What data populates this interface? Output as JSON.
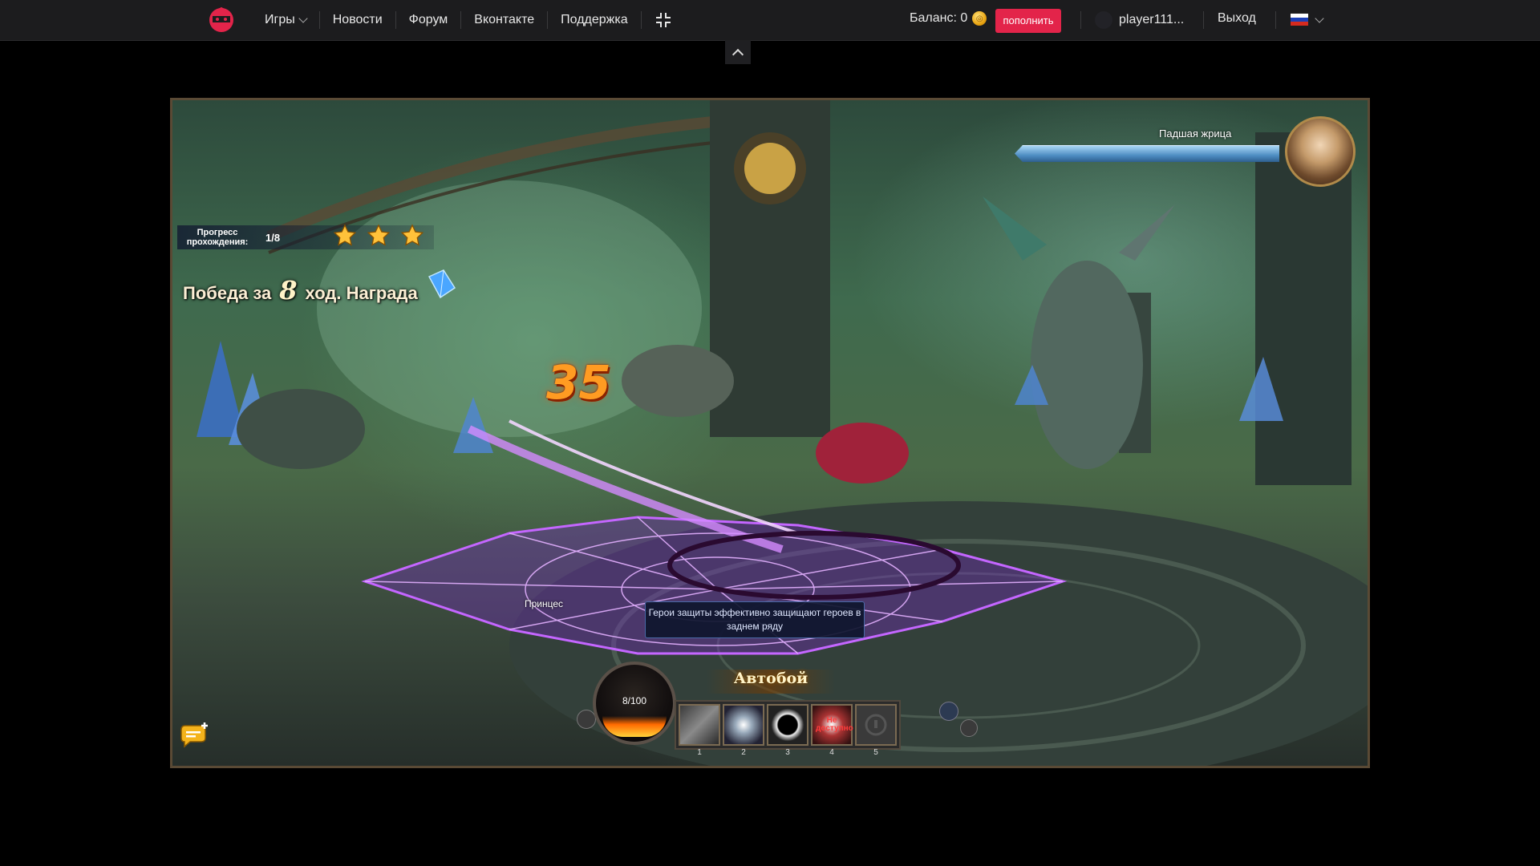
{
  "nav": {
    "items": [
      {
        "label": "Игры",
        "has_dropdown": true
      },
      {
        "label": "Новости"
      },
      {
        "label": "Форум"
      },
      {
        "label": "Вконтакте"
      },
      {
        "label": "Поддержка"
      }
    ],
    "balance_label": "Баланс: 0",
    "topup_label": "пополнить",
    "username": "player111...",
    "logout_label": "Выход",
    "language": "ru",
    "colors": {
      "accent": "#e3244a",
      "bar_bg": "#1c1c1e"
    }
  },
  "game": {
    "progress_label": "Прогресс прохождения:",
    "progress_value": "1/8",
    "stars": 3,
    "victory_prefix": "Победа за",
    "victory_turns": "8",
    "victory_suffix": "ход. Награда",
    "damage_number": "35",
    "boss_name": "Падшая жрица",
    "boss_hp_fraction": 1.0,
    "ally_label": "Принцес",
    "tooltip": "Герои защиты эффективно защищают героев в заднем ряду",
    "energy": "8/100",
    "autobattle_label": "Автобой",
    "skill_slots": [
      {
        "num": "1",
        "icon": "sword-skill-icon"
      },
      {
        "num": "2",
        "icon": "lightning-skill-icon"
      },
      {
        "num": "3",
        "icon": "dark-orb-skill-icon"
      },
      {
        "num": "4",
        "icon": "blood-skill-icon",
        "status": "Не доступно"
      },
      {
        "num": "5",
        "icon": "locked-skill-icon"
      }
    ]
  }
}
